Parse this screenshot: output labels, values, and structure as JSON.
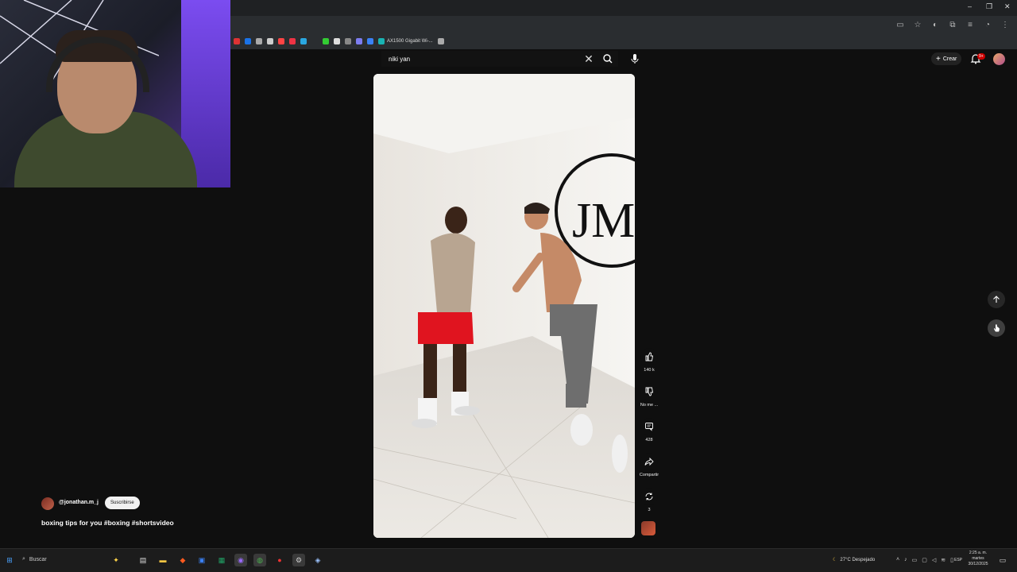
{
  "search": {
    "query": "niki yan"
  },
  "header": {
    "create_label": "Crear",
    "notif_count": "9+"
  },
  "bookmarks": [
    {
      "label": "",
      "color": "#d33"
    },
    {
      "label": "",
      "color": "#1a73e8"
    },
    {
      "label": "",
      "color": "#aaa"
    },
    {
      "label": "",
      "color": "#ccc"
    },
    {
      "label": "",
      "color": "#f44"
    },
    {
      "label": "",
      "color": "#e34"
    },
    {
      "label": "",
      "color": "#2aa7e0"
    },
    {
      "label": "",
      "color": "#3c3"
    },
    {
      "label": "",
      "color": "#ddd"
    },
    {
      "label": "",
      "color": "#888"
    },
    {
      "label": "",
      "color": "#7d7df0"
    },
    {
      "label": "",
      "color": "#3b82f6"
    },
    {
      "label": "AX1500 Gigabit Wi-...",
      "color": "#19b3b3"
    },
    {
      "label": "",
      "color": "#aaa"
    }
  ],
  "actions": {
    "like_count": "140 k",
    "dislike_label": "No me ...",
    "comments_count": "428",
    "share_label": "Compartir",
    "remix_count": "3"
  },
  "channel": {
    "handle": "@jonathan.m_j",
    "subscribe_label": "Suscribirse",
    "title": "boxing tips for you #boxing #shortsvideo"
  },
  "video": {
    "logo_text": "JM"
  },
  "taskbar": {
    "search_label": "Buscar",
    "weather": "27°C  Despejado",
    "lang": "ESP",
    "time": "2:25 a. m.",
    "day": "martes",
    "date": "30/12/2025"
  },
  "colors": {
    "accent_red": "#cc0000",
    "background": "#0f0f0f"
  }
}
